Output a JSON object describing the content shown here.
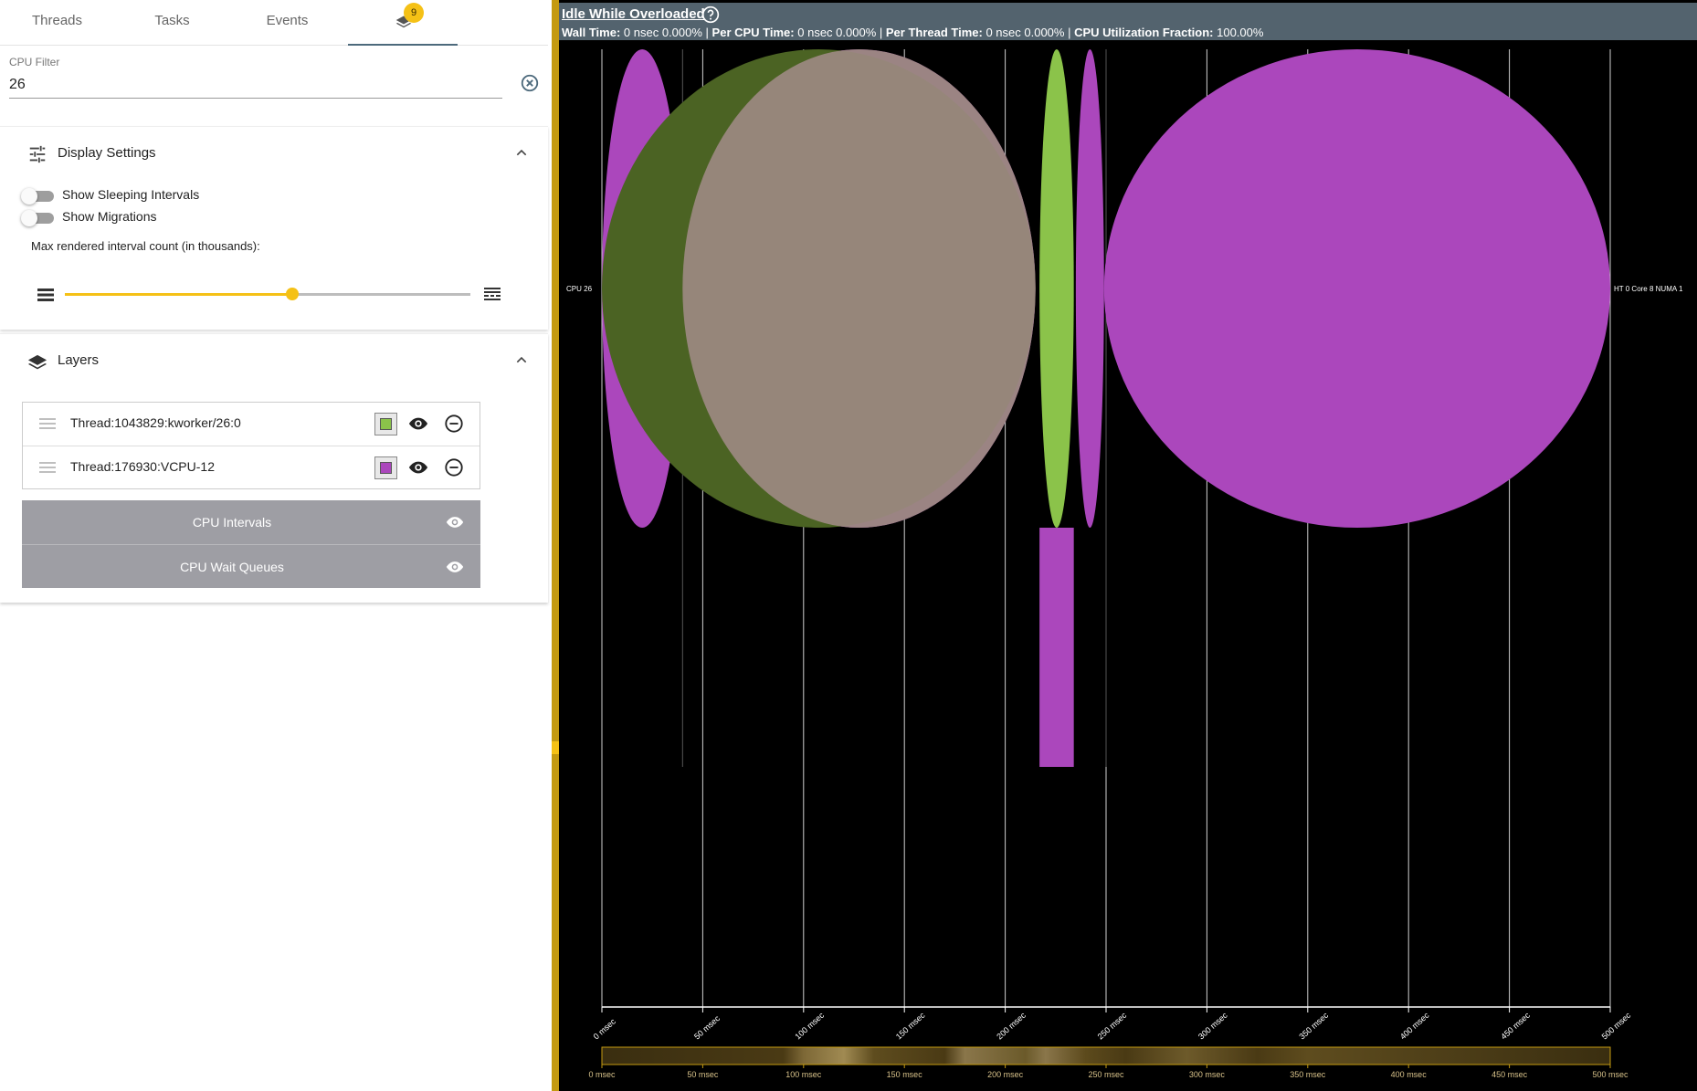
{
  "tabs": [
    {
      "label": "Threads"
    },
    {
      "label": "Tasks"
    },
    {
      "label": "Events"
    },
    {
      "label": "",
      "icon": "layers-icon",
      "badge": "9",
      "active": true
    }
  ],
  "cpu_filter": {
    "label": "CPU Filter",
    "value": "26"
  },
  "display_settings": {
    "title": "Display Settings",
    "toggles": [
      {
        "label": "Show Sleeping Intervals",
        "on": false
      },
      {
        "label": "Show Migrations",
        "on": false
      }
    ],
    "slider": {
      "label": "Max rendered interval count (in thousands):",
      "fraction": 0.56
    }
  },
  "layers": {
    "title": "Layers",
    "items": [
      {
        "name": "Thread:1043829:kworker/26:0",
        "color": "#8bc34a"
      },
      {
        "name": "Thread:176930:VCPU-12",
        "color": "#ab47bc"
      }
    ],
    "fixed": [
      {
        "label": "CPU Intervals"
      },
      {
        "label": "CPU Wait Queues"
      }
    ]
  },
  "header": {
    "title": "Idle While Overloaded",
    "stats": [
      {
        "key": "Wall Time:",
        "value": "0 nsec 0.000%"
      },
      {
        "key": "Per CPU Time:",
        "value": "0 nsec 0.000%"
      },
      {
        "key": "Per Thread Time:",
        "value": "0 nsec 0.000%"
      },
      {
        "key": "CPU Utilization Fraction:",
        "value": "100.00%"
      }
    ]
  },
  "chart_data": {
    "type": "timeline",
    "row_label_left": "CPU 26",
    "row_label_right": "HT 0 Core 8 NUMA 1",
    "x_ticks": [
      "0 msec",
      "50 msec",
      "100 msec",
      "150 msec",
      "200 msec",
      "250 msec",
      "300 msec",
      "350 msec",
      "400 msec",
      "450 msec",
      "500 msec"
    ],
    "xlim": [
      0,
      500
    ],
    "intervals": [
      {
        "layer": "Thread:176930:VCPU-12",
        "start": 0,
        "end": 40,
        "color": "#ab47bc"
      },
      {
        "layer": "Thread:176930:VCPU-12",
        "start": 40,
        "end": 215,
        "color": "#ab47bc"
      },
      {
        "layer": "Thread:1043829:kworker/26:0",
        "start": 0,
        "end": 215,
        "color": "#4b6323"
      },
      {
        "layer": "CPU Intervals",
        "start": 40,
        "end": 215,
        "color": "#9a8880"
      },
      {
        "layer": "Thread:1043829:kworker/26:0",
        "start": 217,
        "end": 234,
        "color": "#8bc34a"
      },
      {
        "layer": "Thread:176930:VCPU-12",
        "start": 235,
        "end": 249,
        "color": "#ab47bc"
      },
      {
        "layer": "Thread:176930:VCPU-12",
        "start": 249,
        "end": 500,
        "color": "#ab47bc"
      }
    ],
    "wait_queue": [
      {
        "layer": "Thread:176930:VCPU-12",
        "start": 217,
        "end": 234,
        "color": "#ab47bc"
      }
    ]
  }
}
